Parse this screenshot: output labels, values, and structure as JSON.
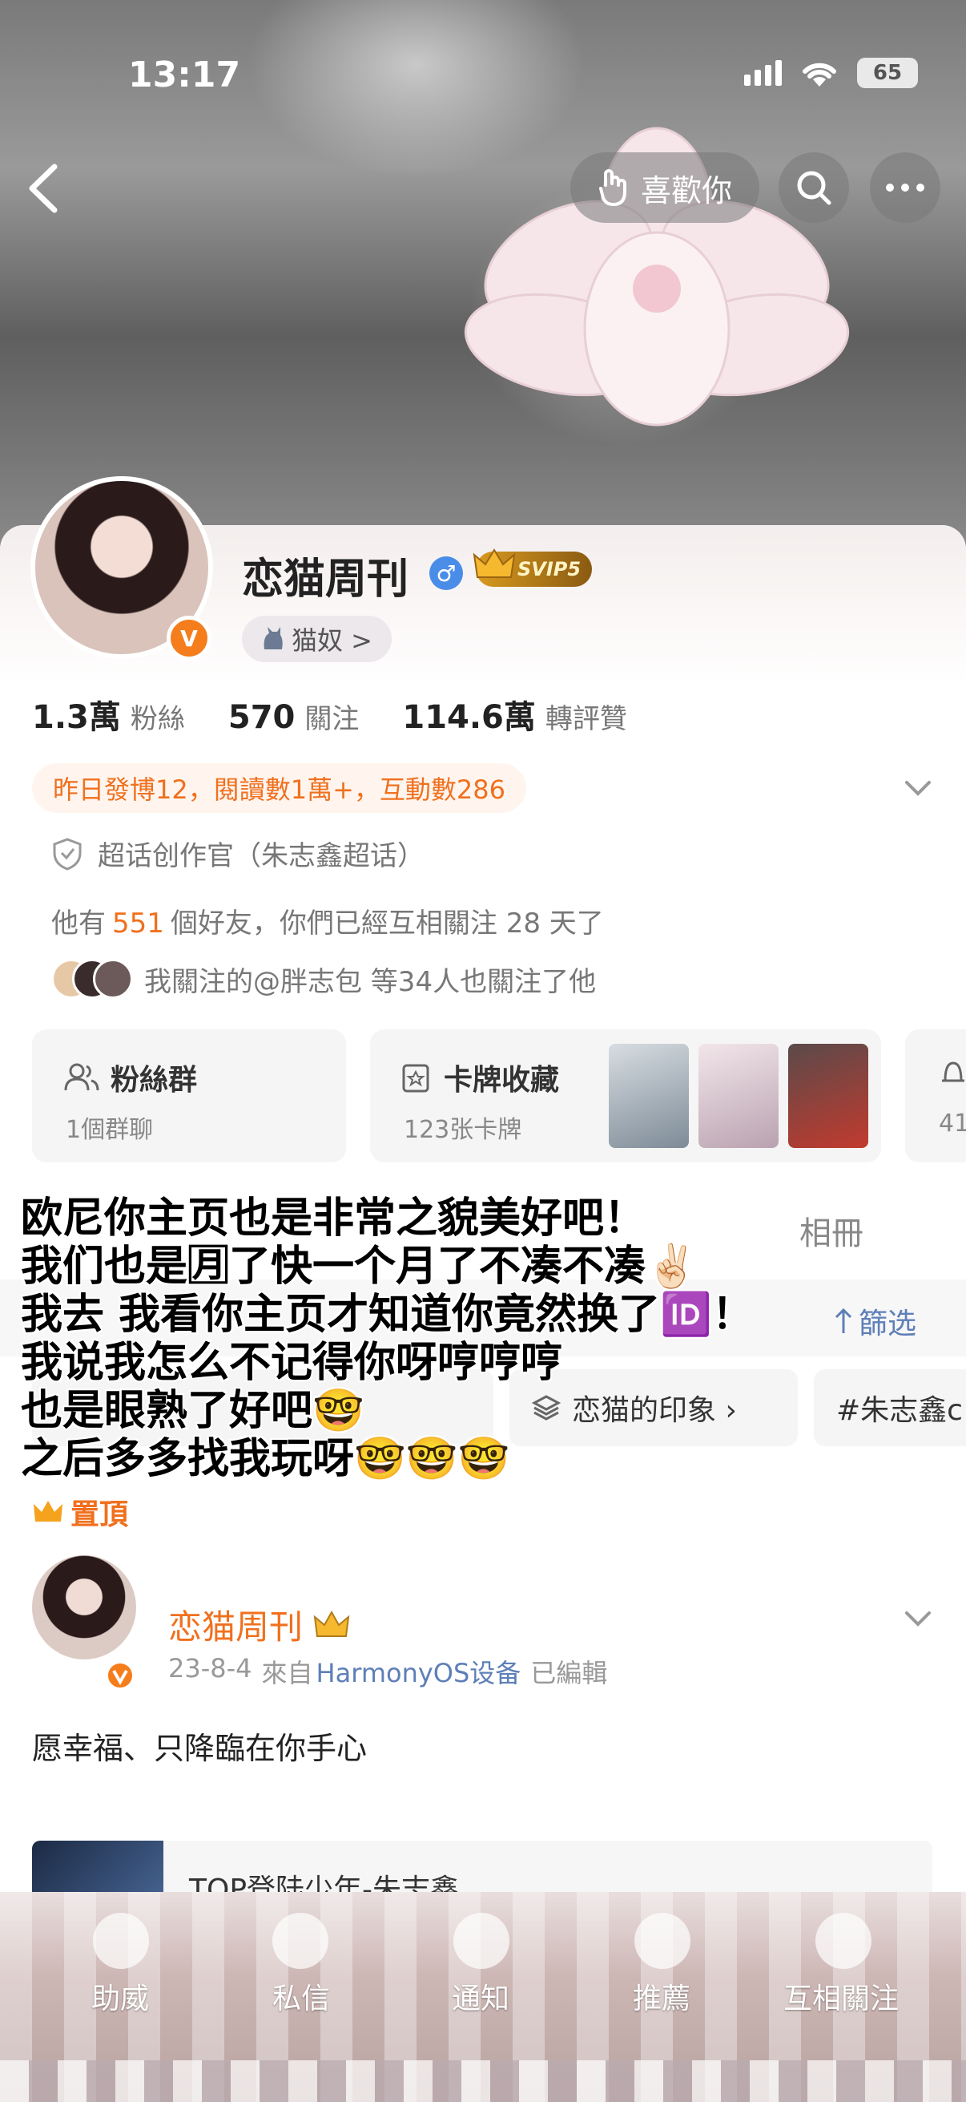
{
  "status": {
    "time": "13:17",
    "battery": "65"
  },
  "nav": {
    "like_label": "喜歡你"
  },
  "profile": {
    "name": "恋猫周刊",
    "gender_symbol": "♂",
    "verified_mark": "V",
    "svip_label": "SVIP5",
    "tag_label": "猫奴 >",
    "stats": [
      {
        "num": "1.3萬",
        "label": "粉絲"
      },
      {
        "num": "570",
        "label": "關注"
      },
      {
        "num": "114.6萬",
        "label": "轉評贊"
      }
    ],
    "activity": "昨日發博12，閱讀數1萬+，互動數286",
    "super_topic": "超话创作官（朱志鑫超话）",
    "friends_prefix": "他有",
    "friends_count": "551",
    "friends_suffix": "個好友，你們已經互相關注 28 天了",
    "mutual": "我關注的@胖志包 等34人也關注了他"
  },
  "features": [
    {
      "title": "粉絲群",
      "sub": "1個群聊",
      "icon": "group-icon"
    },
    {
      "title": "卡牌收藏",
      "sub": "123张卡牌",
      "icon": "card-icon"
    },
    {
      "title": "",
      "sub": "41",
      "icon": "hat-icon"
    }
  ],
  "tabs": {
    "album": "相冊"
  },
  "filter_label": "篩选",
  "chips": [
    {
      "label": "恋猫的印象 ›"
    },
    {
      "label": "#朱志鑫c"
    }
  ],
  "overlay_lines": [
    "欧尼你主页也是非常之貌美好吧！",
    "我们也是🈷了快一个月了不凑不凑✌🏻",
    "我去 我看你主页才知道你竟然换了🆔！",
    "我说我怎么不记得你呀哼哼哼",
    "也是眼熟了好吧🤓",
    "之后多多找我玩呀🤓🤓🤓"
  ],
  "pinned_label": "置頂",
  "post": {
    "author": "恋猫周刊",
    "date": "23-8-4",
    "from": "來自",
    "source": "HarmonyOS设备",
    "edited": "已編輯",
    "text": "愿幸福、只降臨在你手心",
    "link_title": "TOP登陆少年-朱志鑫"
  },
  "bottom_nav": [
    {
      "label": "助威"
    },
    {
      "label": "私信"
    },
    {
      "label": "通知"
    },
    {
      "label": "推薦"
    },
    {
      "label": "互相關注"
    }
  ],
  "colors": {
    "accent_orange": "#f0701e",
    "link_blue": "#5e7fb8",
    "verified_orange": "#f57d1c"
  }
}
